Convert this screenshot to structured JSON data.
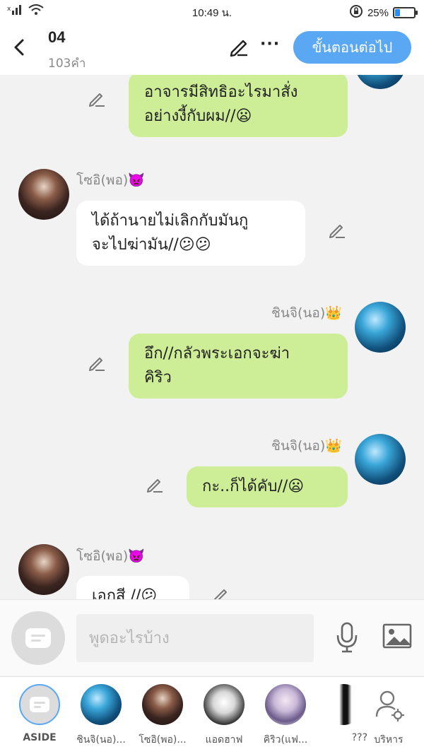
{
  "status_bar": {
    "time": "10:49 น.",
    "battery_text": "25%",
    "battery_level": 0.25,
    "signal_icon": "signal-x-icon",
    "wifi_icon": "wifi-icon",
    "lock_icon": "rotation-lock-icon"
  },
  "header": {
    "title": "04",
    "subtitle": "103คำ",
    "next_label": "ขั้นตอนต่อไป",
    "more_label": "···",
    "accent_color": "#5aa8f3"
  },
  "messages": [
    {
      "side": "right",
      "speaker": "",
      "text_lines": [
        "อาจารมีสิทธิอะไรมาสั่ง",
        "อย่างงี้กับผม//😦"
      ]
    },
    {
      "side": "left",
      "speaker": "โซอิ(พอ)👿",
      "text_lines": [
        "ได้ถ้านายไม่เลิกกับมันกู",
        "จะไปฆ่ามัน//😕😕"
      ]
    },
    {
      "side": "right",
      "speaker": "ชินจิ(นอ)👑",
      "text_lines": [
        "อึก//กลัวพระเอกจะฆ่า",
        "คิริว"
      ]
    },
    {
      "side": "right",
      "speaker": "ชินจิ(นอ)👑",
      "text_lines": [
        "กะ..ก็ได้คับ//😦"
      ]
    },
    {
      "side": "left",
      "speaker": "โซอิ(พอ)👿",
      "text_lines": [
        "เอกสี //😕"
      ]
    }
  ],
  "colors": {
    "right_bubble": "#cdee97",
    "left_bubble": "#ffffff",
    "background": "#f2f2f2"
  },
  "input": {
    "placeholder": "พูดอะไรบ้าง"
  },
  "characters": [
    {
      "label": "ASIDE"
    },
    {
      "label": "ชินจิ(นอ)..."
    },
    {
      "label": "โซอิ(พอ)..."
    },
    {
      "label": "แอดฮาฟ"
    },
    {
      "label": "คิริว(แฟ..."
    },
    {
      "label": "???"
    },
    {
      "label": "บริหาร"
    }
  ]
}
